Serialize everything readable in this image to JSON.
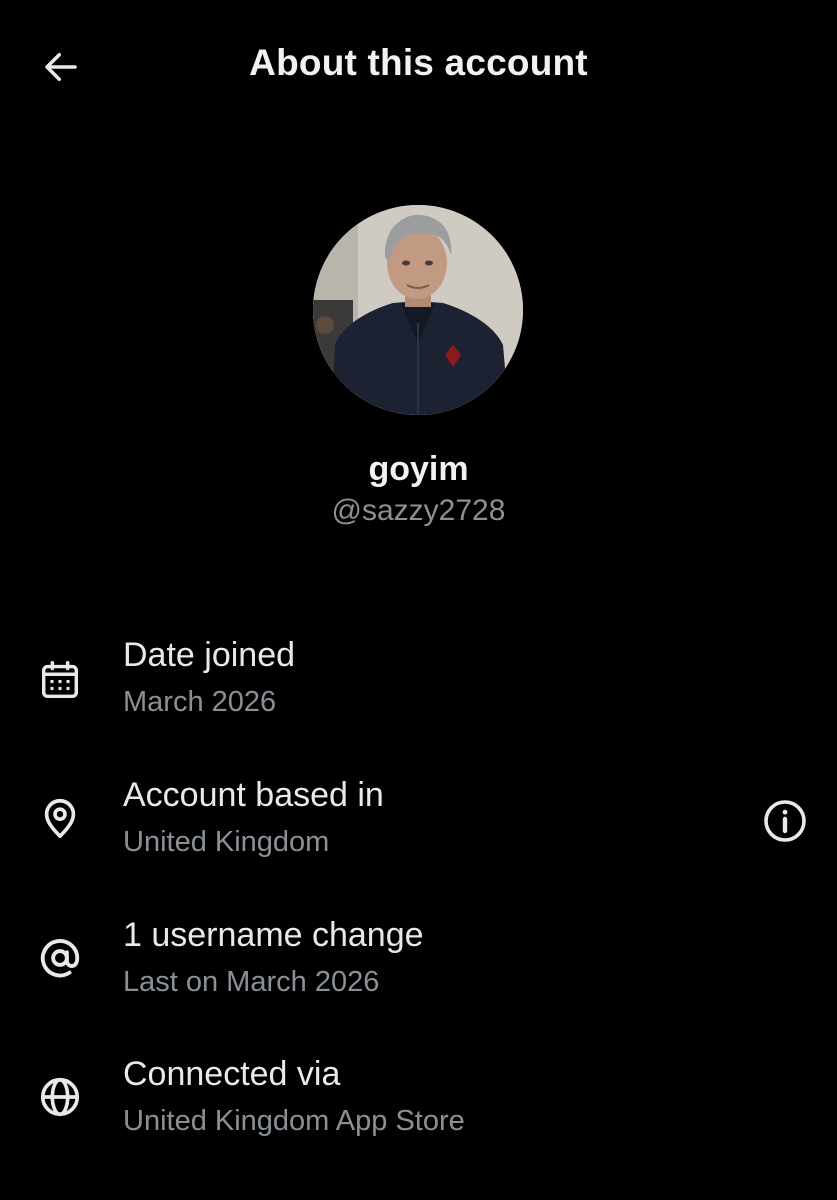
{
  "header": {
    "title": "About this account",
    "back_icon": "arrow-left-icon"
  },
  "profile": {
    "display_name": "goyim",
    "handle": "@sazzy2728",
    "avatar_icon": "profile-photo"
  },
  "details": [
    {
      "icon": "calendar-icon",
      "label": "Date joined",
      "value": "March 2026"
    },
    {
      "icon": "location-pin-icon",
      "label": "Account based in",
      "value": "United Kingdom",
      "trailing_icon": "info-icon"
    },
    {
      "icon": "at-sign-icon",
      "label": "1 username change",
      "value": "Last on March 2026"
    },
    {
      "icon": "globe-icon",
      "label": "Connected via",
      "value": "United Kingdom App Store"
    }
  ],
  "colors": {
    "background": "#000000",
    "primary_text": "#e7e9ea",
    "secondary_text": "#8b9096",
    "icon": "#e7e9ea"
  }
}
